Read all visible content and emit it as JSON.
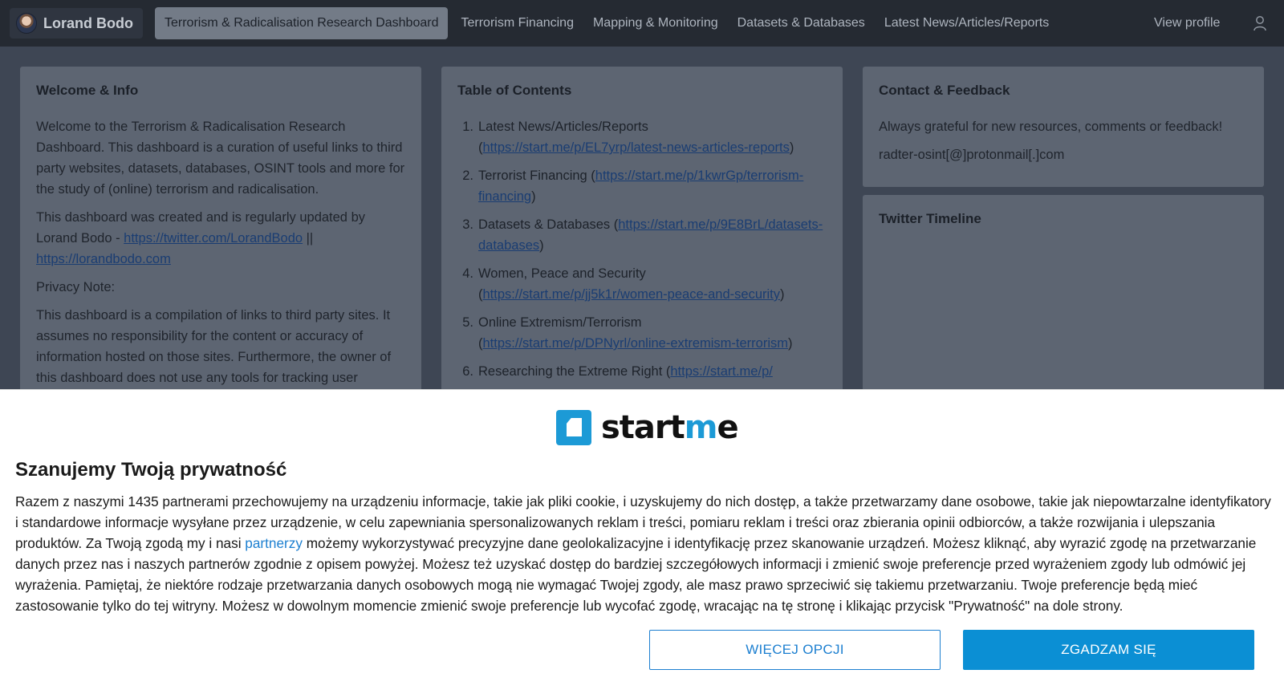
{
  "topbar": {
    "brand_name": "Lorand Bodo",
    "nav": [
      "Terrorism & Radicalisation Research Dashboard",
      "Terrorism Financing",
      "Mapping & Monitoring",
      "Datasets & Databases",
      "Latest News/Articles/Reports"
    ],
    "view_profile": "View profile",
    "user_icon": "user-icon"
  },
  "welcome": {
    "title": "Welcome & Info",
    "p1": "Welcome to the Terrorism & Radicalisation Research Dashboard. This dashboard is a curation of useful links to third party websites, datasets, databases, OSINT tools and more for the study of (online) terrorism and radicalisation.",
    "p2_text": "This dashboard was created and is regularly updated by Lorand Bodo - ",
    "p2_link1": "https://twitter.com/LorandBodo",
    "p2_sep": " || ",
    "p2_link2": "https://lorandbodo.com",
    "p3": "Privacy Note:",
    "p4": "This dashboard is a compilation of links to third party sites. It assumes no responsibility for the content or accuracy of information hosted on those sites. Furthermore, the owner of this dashboard does not use any tools for tracking user"
  },
  "toc": {
    "title": "Table of Contents",
    "items": [
      {
        "num": "1.",
        "text": "Latest News/Articles/Reports (",
        "link": "https://start.me/p/EL7yrp/latest-news-articles-reports",
        "end": ")"
      },
      {
        "num": "2.",
        "text": "Terrorist Financing (",
        "link": "https://start.me/p/1kwrGp/terrorism-financing",
        "end": ")"
      },
      {
        "num": "3.",
        "text": "Datasets & Databases (",
        "link": "https://start.me/p/9E8BrL/datasets-databases",
        "end": ")"
      },
      {
        "num": "4.",
        "text": "Women, Peace and Security (",
        "link": "https://start.me/p/jj5k1r/women-peace-and-security",
        "end": ")"
      },
      {
        "num": "5.",
        "text": "Online Extremism/Terrorism (",
        "link": "https://start.me/p/DPNyrl/online-extremism-terrorism",
        "end": ")"
      },
      {
        "num": "6.",
        "text": "Researching the Extreme Right (",
        "link": "https://start.me/p/",
        "end": ""
      }
    ]
  },
  "contact": {
    "title": "Contact & Feedback",
    "p1": "Always grateful for new resources, comments or feedback!",
    "p2": "radter-osint[@]protonmail[.]com"
  },
  "twitter": {
    "title": "Twitter Timeline"
  },
  "consent": {
    "logo_text_a": "start",
    "logo_text_dot": "m",
    "logo_text_b": "e",
    "title": "Szanujemy Twoją prywatność",
    "body_a": "Razem z naszymi 1435 partnerami przechowujemy na urządzeniu informacje, takie jak pliki cookie, i uzyskujemy do nich dostęp, a także przetwarzamy dane osobowe, takie jak niepowtarzalne identyfikatory i standardowe informacje wysyłane przez urządzenie, w celu zapewniania spersonalizowanych reklam i treści, pomiaru reklam i treści oraz zbierania opinii odbiorców, a także rozwijania i ulepszania produktów. Za Twoją zgodą my i nasi ",
    "body_link": "partnerzy",
    "body_b": " możemy wykorzystywać precyzyjne dane geolokalizacyjne i identyfikację przez skanowanie urządzeń. Możesz kliknąć, aby wyrazić zgodę na przetwarzanie danych przez nas i naszych partnerów zgodnie z opisem powyżej. Możesz też uzyskać dostęp do bardziej szczegółowych informacji i zmienić swoje preferencje przed wyrażeniem zgody lub odmówić jej wyrażenia. Pamiętaj, że niektóre rodzaje przetwarzania danych osobowych mogą nie wymagać Twojej zgody, ale masz prawo sprzeciwić się takiemu przetwarzaniu. Twoje preferencje będą mieć zastosowanie tylko do tej witryny. Możesz w dowolnym momencie zmienić swoje preferencje lub wycofać zgodę, wracając na tę stronę i klikając przycisk \"Prywatność\" na dole strony.",
    "more_options": "WIĘCEJ OPCJI",
    "agree": "ZGADZAM SIĘ"
  },
  "colors": {
    "topbar_bg": "#252a32",
    "page_bg": "#3e4654",
    "panel_bg": "#5d6572",
    "accent": "#0b8fd4"
  }
}
